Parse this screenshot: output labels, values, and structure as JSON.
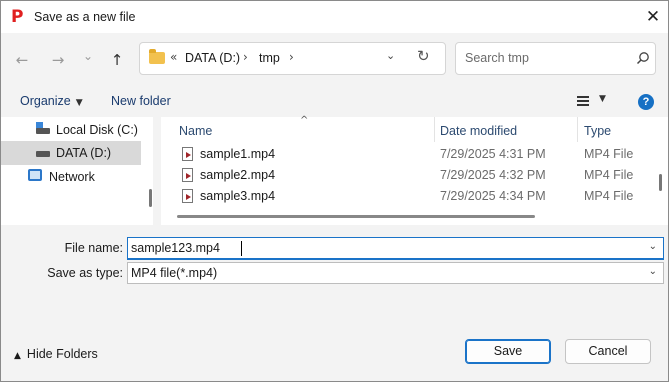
{
  "window": {
    "title": "Save as a new file",
    "app_icon_glyph": "P",
    "app_icon_color": "#e02020",
    "close_glyph": "✕"
  },
  "nav": {
    "back_glyph": "←",
    "forward_glyph": "→",
    "recent_glyph": "⌄",
    "up_glyph": "↑",
    "overflow_glyph": "«",
    "path_sep_glyph": "›",
    "drop_glyph": "⌄",
    "refresh_glyph": "↻",
    "breadcrumb": [
      "DATA (D:)",
      "tmp"
    ]
  },
  "search": {
    "placeholder": "Search tmp"
  },
  "toolbar": {
    "organize_label": "Organize",
    "organize_caret": "▼",
    "new_folder_label": "New folder",
    "view_caret": "▼",
    "help_glyph": "?",
    "accent_color": "#1670c4"
  },
  "tree": {
    "items": [
      {
        "label": "Local Disk (C:)",
        "icon": "windows-drive-icon",
        "selected": false
      },
      {
        "label": "DATA (D:)",
        "icon": "drive-icon",
        "selected": true
      },
      {
        "label": "Network",
        "icon": "network-icon",
        "selected": false
      }
    ]
  },
  "files": {
    "columns": [
      "Name",
      "Date modified",
      "Type"
    ],
    "sort_glyph": "^",
    "rows": [
      {
        "name": "sample1.mp4",
        "date": "7/29/2025 4:31 PM",
        "type": "MP4 File"
      },
      {
        "name": "sample2.mp4",
        "date": "7/29/2025 4:32 PM",
        "type": "MP4 File"
      },
      {
        "name": "sample3.mp4",
        "date": "7/29/2025 4:34 PM",
        "type": "MP4 File"
      }
    ]
  },
  "form": {
    "filename_label": "File name:",
    "filename_value": "sample123.mp4",
    "savetype_label": "Save as type:",
    "savetype_value": "MP4 file(*.mp4)",
    "caret_glyph": "⌄"
  },
  "footer": {
    "hide_folders_label": "Hide Folders",
    "hide_caret": "▲",
    "save_label": "Save",
    "cancel_label": "Cancel"
  }
}
